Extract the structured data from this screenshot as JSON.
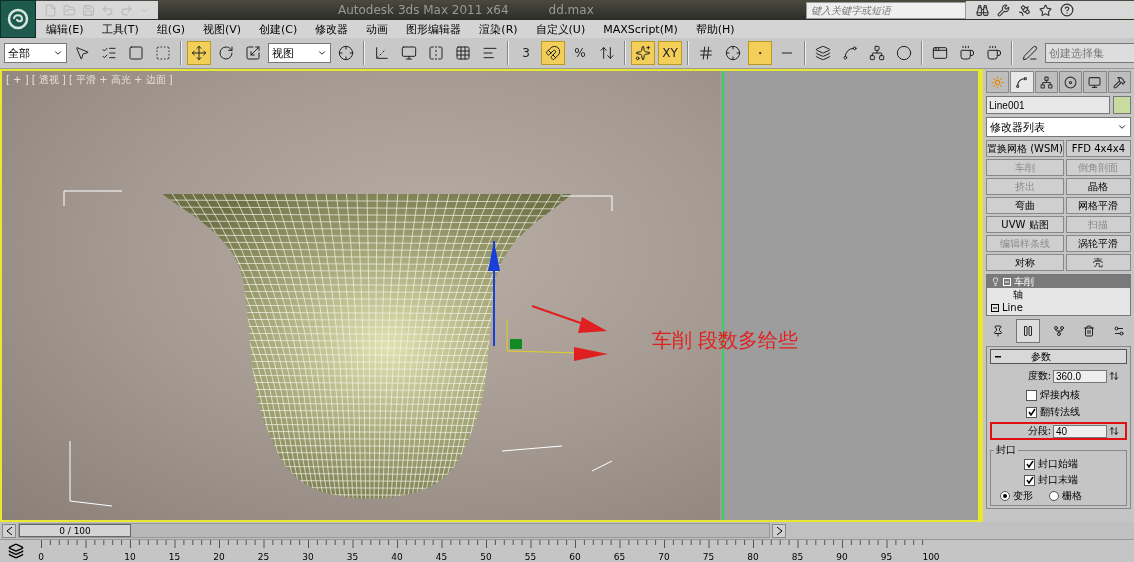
{
  "title_bar": {
    "title": "Autodesk 3ds Max  2011 x64",
    "file": "dd.max",
    "search": {
      "placeholder": "键入关键字或短语"
    }
  },
  "menu": [
    "编辑(E)",
    "工具(T)",
    "组(G)",
    "视图(V)",
    "创建(C)",
    "修改器",
    "动画",
    "图形编辑器",
    "渲染(R)",
    "自定义(U)",
    "MAXScript(M)",
    "帮助(H)"
  ],
  "toolbar": [
    {
      "kind": "dropdown",
      "value": "全部"
    },
    {
      "kind": "button",
      "active": false
    },
    {
      "kind": "button",
      "active": false
    },
    {
      "kind": "button",
      "active": false
    },
    {
      "kind": "button",
      "active": false
    },
    {
      "kind": "separator"
    },
    {
      "kind": "button",
      "active": true
    },
    {
      "kind": "button",
      "active": false
    },
    {
      "kind": "button",
      "active": false
    },
    {
      "kind": "dropdown",
      "value": "视图"
    },
    {
      "kind": "button",
      "active": false
    },
    {
      "kind": "separator"
    },
    {
      "kind": "button",
      "active": false
    },
    {
      "kind": "button",
      "active": false
    },
    {
      "kind": "button",
      "active": false
    },
    {
      "kind": "button",
      "active": false
    },
    {
      "kind": "button",
      "active": false
    },
    {
      "kind": "separator"
    },
    {
      "kind": "button",
      "active": false,
      "label": "3"
    },
    {
      "kind": "button",
      "active": true
    },
    {
      "kind": "button",
      "active": false,
      "label": "%"
    },
    {
      "kind": "button",
      "active": false
    },
    {
      "kind": "separator"
    },
    {
      "kind": "button",
      "active": true
    },
    {
      "kind": "button",
      "active": true,
      "label": "XY"
    },
    {
      "kind": "separator"
    },
    {
      "kind": "button",
      "active": false
    },
    {
      "kind": "button",
      "active": false
    },
    {
      "kind": "button",
      "active": true
    },
    {
      "kind": "button",
      "active": false
    },
    {
      "kind": "separator"
    },
    {
      "kind": "button",
      "active": false
    },
    {
      "kind": "button",
      "active": false
    },
    {
      "kind": "button",
      "active": false
    },
    {
      "kind": "button",
      "active": false
    },
    {
      "kind": "separator"
    },
    {
      "kind": "button",
      "active": false
    },
    {
      "kind": "button",
      "active": false
    },
    {
      "kind": "button",
      "active": false
    },
    {
      "kind": "separator"
    },
    {
      "kind": "button",
      "active": false
    },
    {
      "kind": "dropdown",
      "placeholder": "创建选择集"
    }
  ],
  "viewport": {
    "label": "[ + ] [ 透视 ] [ 平滑 + 高光 + 边面 ]",
    "annotation": "车削  段数多给些"
  },
  "command_panel": {
    "tabs": [
      {
        "selected": false
      },
      {
        "selected": true
      },
      {
        "selected": false
      },
      {
        "selected": false
      },
      {
        "selected": false
      },
      {
        "selected": false
      }
    ],
    "object_name": "Line001",
    "modifier_list": "修改器列表",
    "modifiers": [
      {
        "label": "置换网格 (WSM)",
        "disabled": false
      },
      {
        "label": "FFD 4x4x4",
        "disabled": false
      },
      {
        "label": "车削",
        "disabled": true
      },
      {
        "label": "倒角剖面",
        "disabled": true
      },
      {
        "label": "挤出",
        "disabled": true
      },
      {
        "label": "晶格",
        "disabled": false
      },
      {
        "label": "弯曲",
        "disabled": false
      },
      {
        "label": "网格平滑",
        "disabled": false
      },
      {
        "label": "UVW 贴图",
        "disabled": false
      },
      {
        "label": "扫描",
        "disabled": true
      },
      {
        "label": "编辑样条线",
        "disabled": true
      },
      {
        "label": "涡轮平滑",
        "disabled": false
      },
      {
        "label": "对称",
        "disabled": false
      },
      {
        "label": "壳",
        "disabled": false
      }
    ],
    "stack": [
      {
        "label": "车削",
        "selected": true,
        "expanded": true,
        "children": [
          {
            "label": "轴",
            "selected": false
          }
        ]
      },
      {
        "label": "Line",
        "selected": false,
        "expanded": true
      }
    ],
    "stack_tools": [
      {
        "active": false
      },
      {
        "active": true
      },
      {
        "active": false
      },
      {
        "active": false
      },
      {
        "active": false
      }
    ],
    "rollout": {
      "title": "参数",
      "expanded": true,
      "degrees": {
        "label": "度数:",
        "value": "360.0"
      },
      "weld_core": {
        "label": "焊接内核",
        "checked": false
      },
      "flip_normals": {
        "label": "翻转法线",
        "checked": true
      },
      "segments": {
        "label": "分段:",
        "value": "40",
        "highlighted": true
      },
      "capping": {
        "title": "封口",
        "start": {
          "label": "封口始端",
          "checked": true
        },
        "end": {
          "label": "封口末端",
          "checked": true
        },
        "options": [
          {
            "label": "变形",
            "selected": true
          },
          {
            "label": "栅格",
            "selected": false
          }
        ]
      }
    }
  },
  "timeline": {
    "position": "0 / 100",
    "level": 0,
    "ruler": [
      "0",
      "5",
      "10",
      "15",
      "20",
      "25",
      "30",
      "35",
      "40",
      "45",
      "50",
      "55",
      "60",
      "65",
      "70",
      "75",
      "80",
      "85",
      "90",
      "95",
      "100"
    ]
  }
}
